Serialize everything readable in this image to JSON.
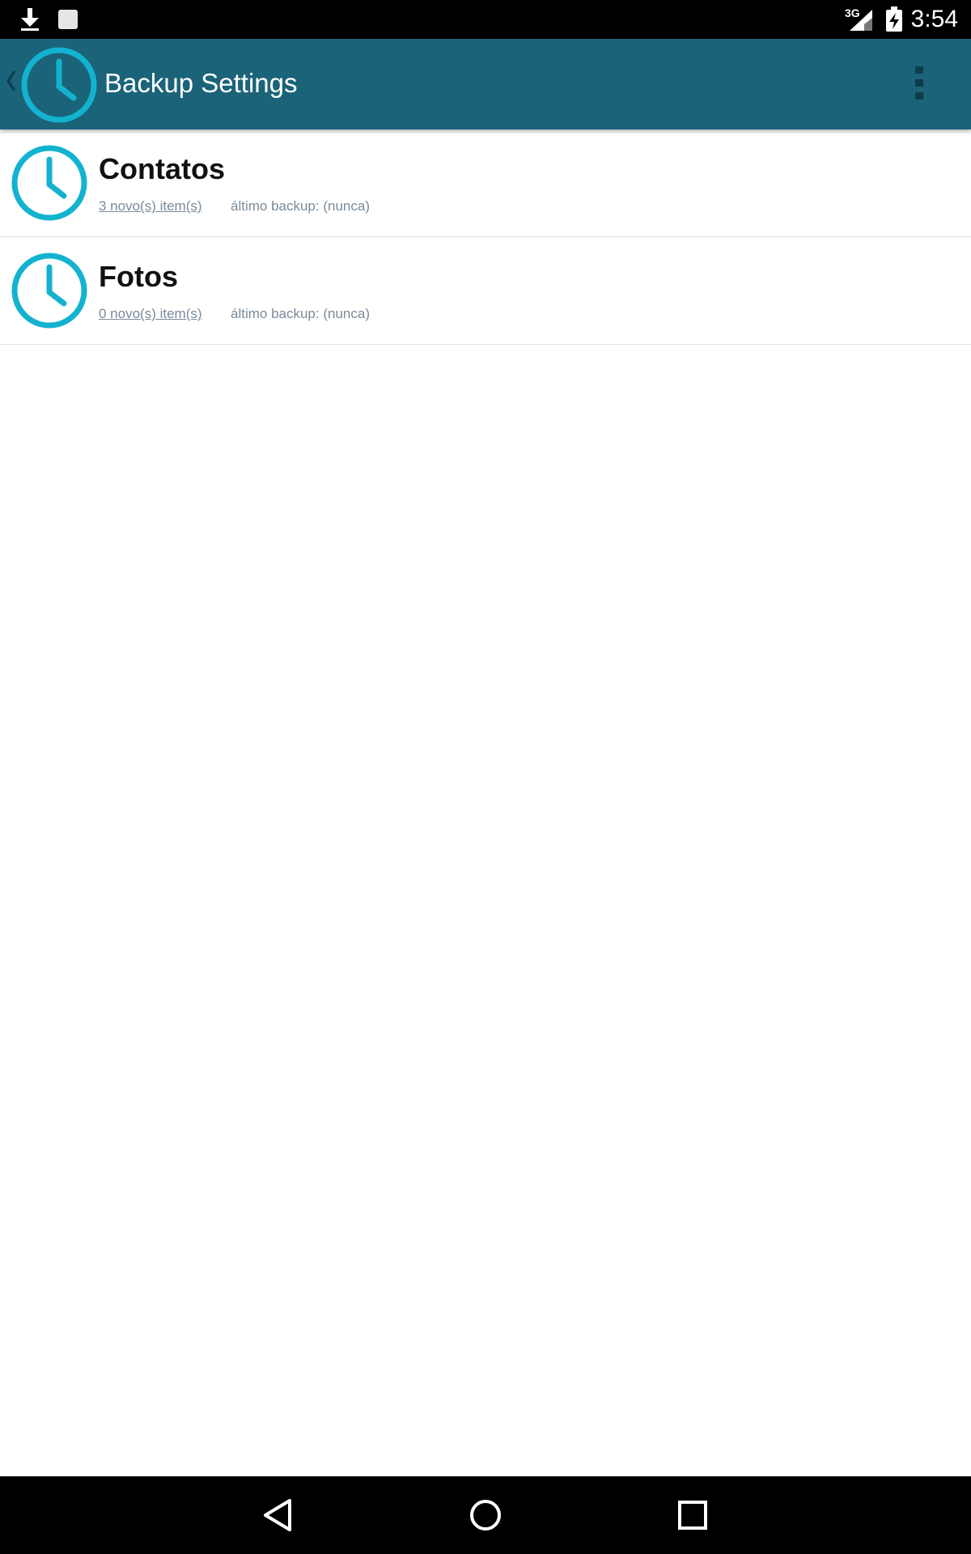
{
  "status_bar": {
    "time": "3:54",
    "network": "3G",
    "icons": [
      "download-icon",
      "notification-square-icon",
      "signal-icon",
      "battery-charging-icon"
    ]
  },
  "app_bar": {
    "title": "Backup Settings",
    "icons": [
      "back-caret-icon",
      "clock-logo-icon",
      "overflow-menu-icon"
    ],
    "background": "#1b6379"
  },
  "list": {
    "items": [
      {
        "title": "Contatos",
        "new_items": "3 novo(s) item(s)",
        "last_backup": "áltimo backup: (nunca)",
        "icon": "clock-icon"
      },
      {
        "title": "Fotos",
        "new_items": "0 novo(s) item(s)",
        "last_backup": "áltimo backup: (nunca)",
        "icon": "clock-icon"
      }
    ]
  },
  "nav_bar": {
    "buttons": [
      "back-triangle-icon",
      "home-circle-icon",
      "recents-square-icon"
    ]
  },
  "colors": {
    "accent": "#13b3d0",
    "app_bar": "#1b6379",
    "secondary_text": "#7a8a99"
  }
}
